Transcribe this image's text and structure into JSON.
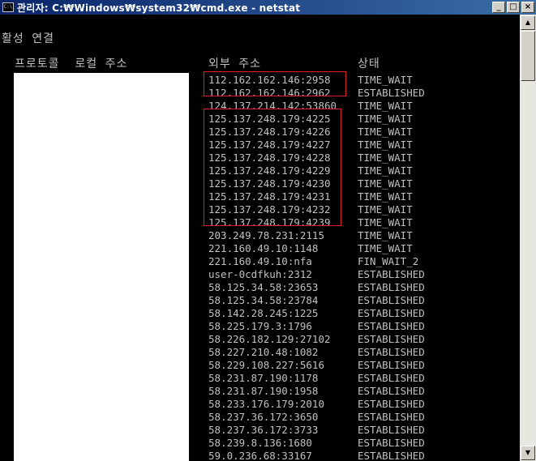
{
  "window": {
    "title": "관리자: C:₩Windows₩system32₩cmd.exe - netstat",
    "icon_label": "C:\\",
    "controls": {
      "minimize": "_",
      "maximize": "□",
      "close": "×"
    }
  },
  "console": {
    "heading": "활성 연결",
    "columns": {
      "protocol_local": "프로토콜  로컬 주소",
      "foreign": "외부 주소",
      "state": "상태"
    },
    "rows": [
      {
        "foreign": "112.162.162.146:2958",
        "state": "TIME_WAIT"
      },
      {
        "foreign": "112.162.162.146:2962",
        "state": "ESTABLISHED"
      },
      {
        "foreign": "124.137.214.142:53860",
        "state": "TIME_WAIT"
      },
      {
        "foreign": "125.137.248.179:4225",
        "state": "TIME_WAIT"
      },
      {
        "foreign": "125.137.248.179:4226",
        "state": "TIME_WAIT"
      },
      {
        "foreign": "125.137.248.179:4227",
        "state": "TIME_WAIT"
      },
      {
        "foreign": "125.137.248.179:4228",
        "state": "TIME_WAIT"
      },
      {
        "foreign": "125.137.248.179:4229",
        "state": "TIME_WAIT"
      },
      {
        "foreign": "125.137.248.179:4230",
        "state": "TIME_WAIT"
      },
      {
        "foreign": "125.137.248.179:4231",
        "state": "TIME_WAIT"
      },
      {
        "foreign": "125.137.248.179:4232",
        "state": "TIME_WAIT"
      },
      {
        "foreign": "125.137.248.179:4239",
        "state": "TIME_WAIT"
      },
      {
        "foreign": "203.249.78.231:2115",
        "state": "TIME_WAIT"
      },
      {
        "foreign": "221.160.49.10:1148",
        "state": "TIME_WAIT"
      },
      {
        "foreign": "221.160.49.10:nfa",
        "state": "FIN_WAIT_2"
      },
      {
        "foreign": "user-0cdfkuh:2312",
        "state": "ESTABLISHED"
      },
      {
        "foreign": "58.125.34.58:23653",
        "state": "ESTABLISHED"
      },
      {
        "foreign": "58.125.34.58:23784",
        "state": "ESTABLISHED"
      },
      {
        "foreign": "58.142.28.245:1225",
        "state": "ESTABLISHED"
      },
      {
        "foreign": "58.225.179.3:1796",
        "state": "ESTABLISHED"
      },
      {
        "foreign": "58.226.182.129:27102",
        "state": "ESTABLISHED"
      },
      {
        "foreign": "58.227.210.48:1082",
        "state": "ESTABLISHED"
      },
      {
        "foreign": "58.229.108.227:5616",
        "state": "ESTABLISHED"
      },
      {
        "foreign": "58.231.87.190:1178",
        "state": "ESTABLISHED"
      },
      {
        "foreign": "58.231.87.190:1958",
        "state": "ESTABLISHED"
      },
      {
        "foreign": "58.233.176.179:2010",
        "state": "ESTABLISHED"
      },
      {
        "foreign": "58.237.36.172:3650",
        "state": "ESTABLISHED"
      },
      {
        "foreign": "58.237.36.172:3733",
        "state": "ESTABLISHED"
      },
      {
        "foreign": "58.239.8.136:1680",
        "state": "ESTABLISHED"
      },
      {
        "foreign": "59.0.236.68:33167",
        "state": "ESTABLISHED"
      }
    ]
  },
  "scrollbar": {
    "up_arrow": "▲",
    "down_arrow": "▼"
  },
  "colors": {
    "console_bg": "#000000",
    "console_text": "#c0c0c0",
    "highlight_box": "#e02020",
    "redaction": "#ffffff"
  }
}
